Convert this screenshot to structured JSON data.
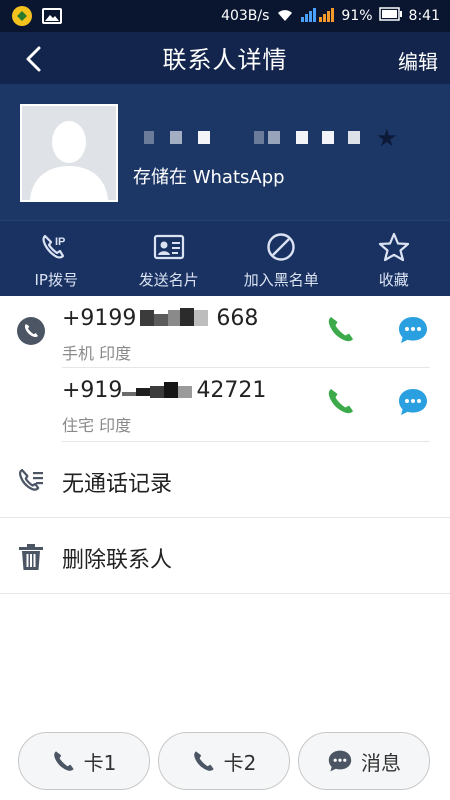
{
  "status_bar": {
    "net_speed": "403B/s",
    "battery": "91%",
    "time": "8:41"
  },
  "header": {
    "title": "联系人详情",
    "edit_label": "编辑"
  },
  "profile": {
    "storage_text": "存储在 WhatsApp"
  },
  "actions": [
    {
      "label": "IP拨号",
      "icon": "ip-call-icon"
    },
    {
      "label": "发送名片",
      "icon": "card-icon"
    },
    {
      "label": "加入黑名单",
      "icon": "block-icon"
    },
    {
      "label": "收藏",
      "icon": "star-icon"
    }
  ],
  "phones": [
    {
      "number": "+9199",
      "number_tail": "668",
      "type": "手机 印度"
    },
    {
      "number": "+919",
      "number_tail": "42721",
      "type": "住宅 印度"
    }
  ],
  "rows": {
    "call_log": "无通话记录",
    "delete": "删除联系人"
  },
  "bottom": {
    "sim1": "卡1",
    "sim2": "卡2",
    "message": "消息"
  },
  "colors": {
    "header_bg": "#13254c",
    "profile_bg": "#1c3666",
    "call_green": "#3caa4b",
    "msg_blue": "#2aa0e0"
  }
}
